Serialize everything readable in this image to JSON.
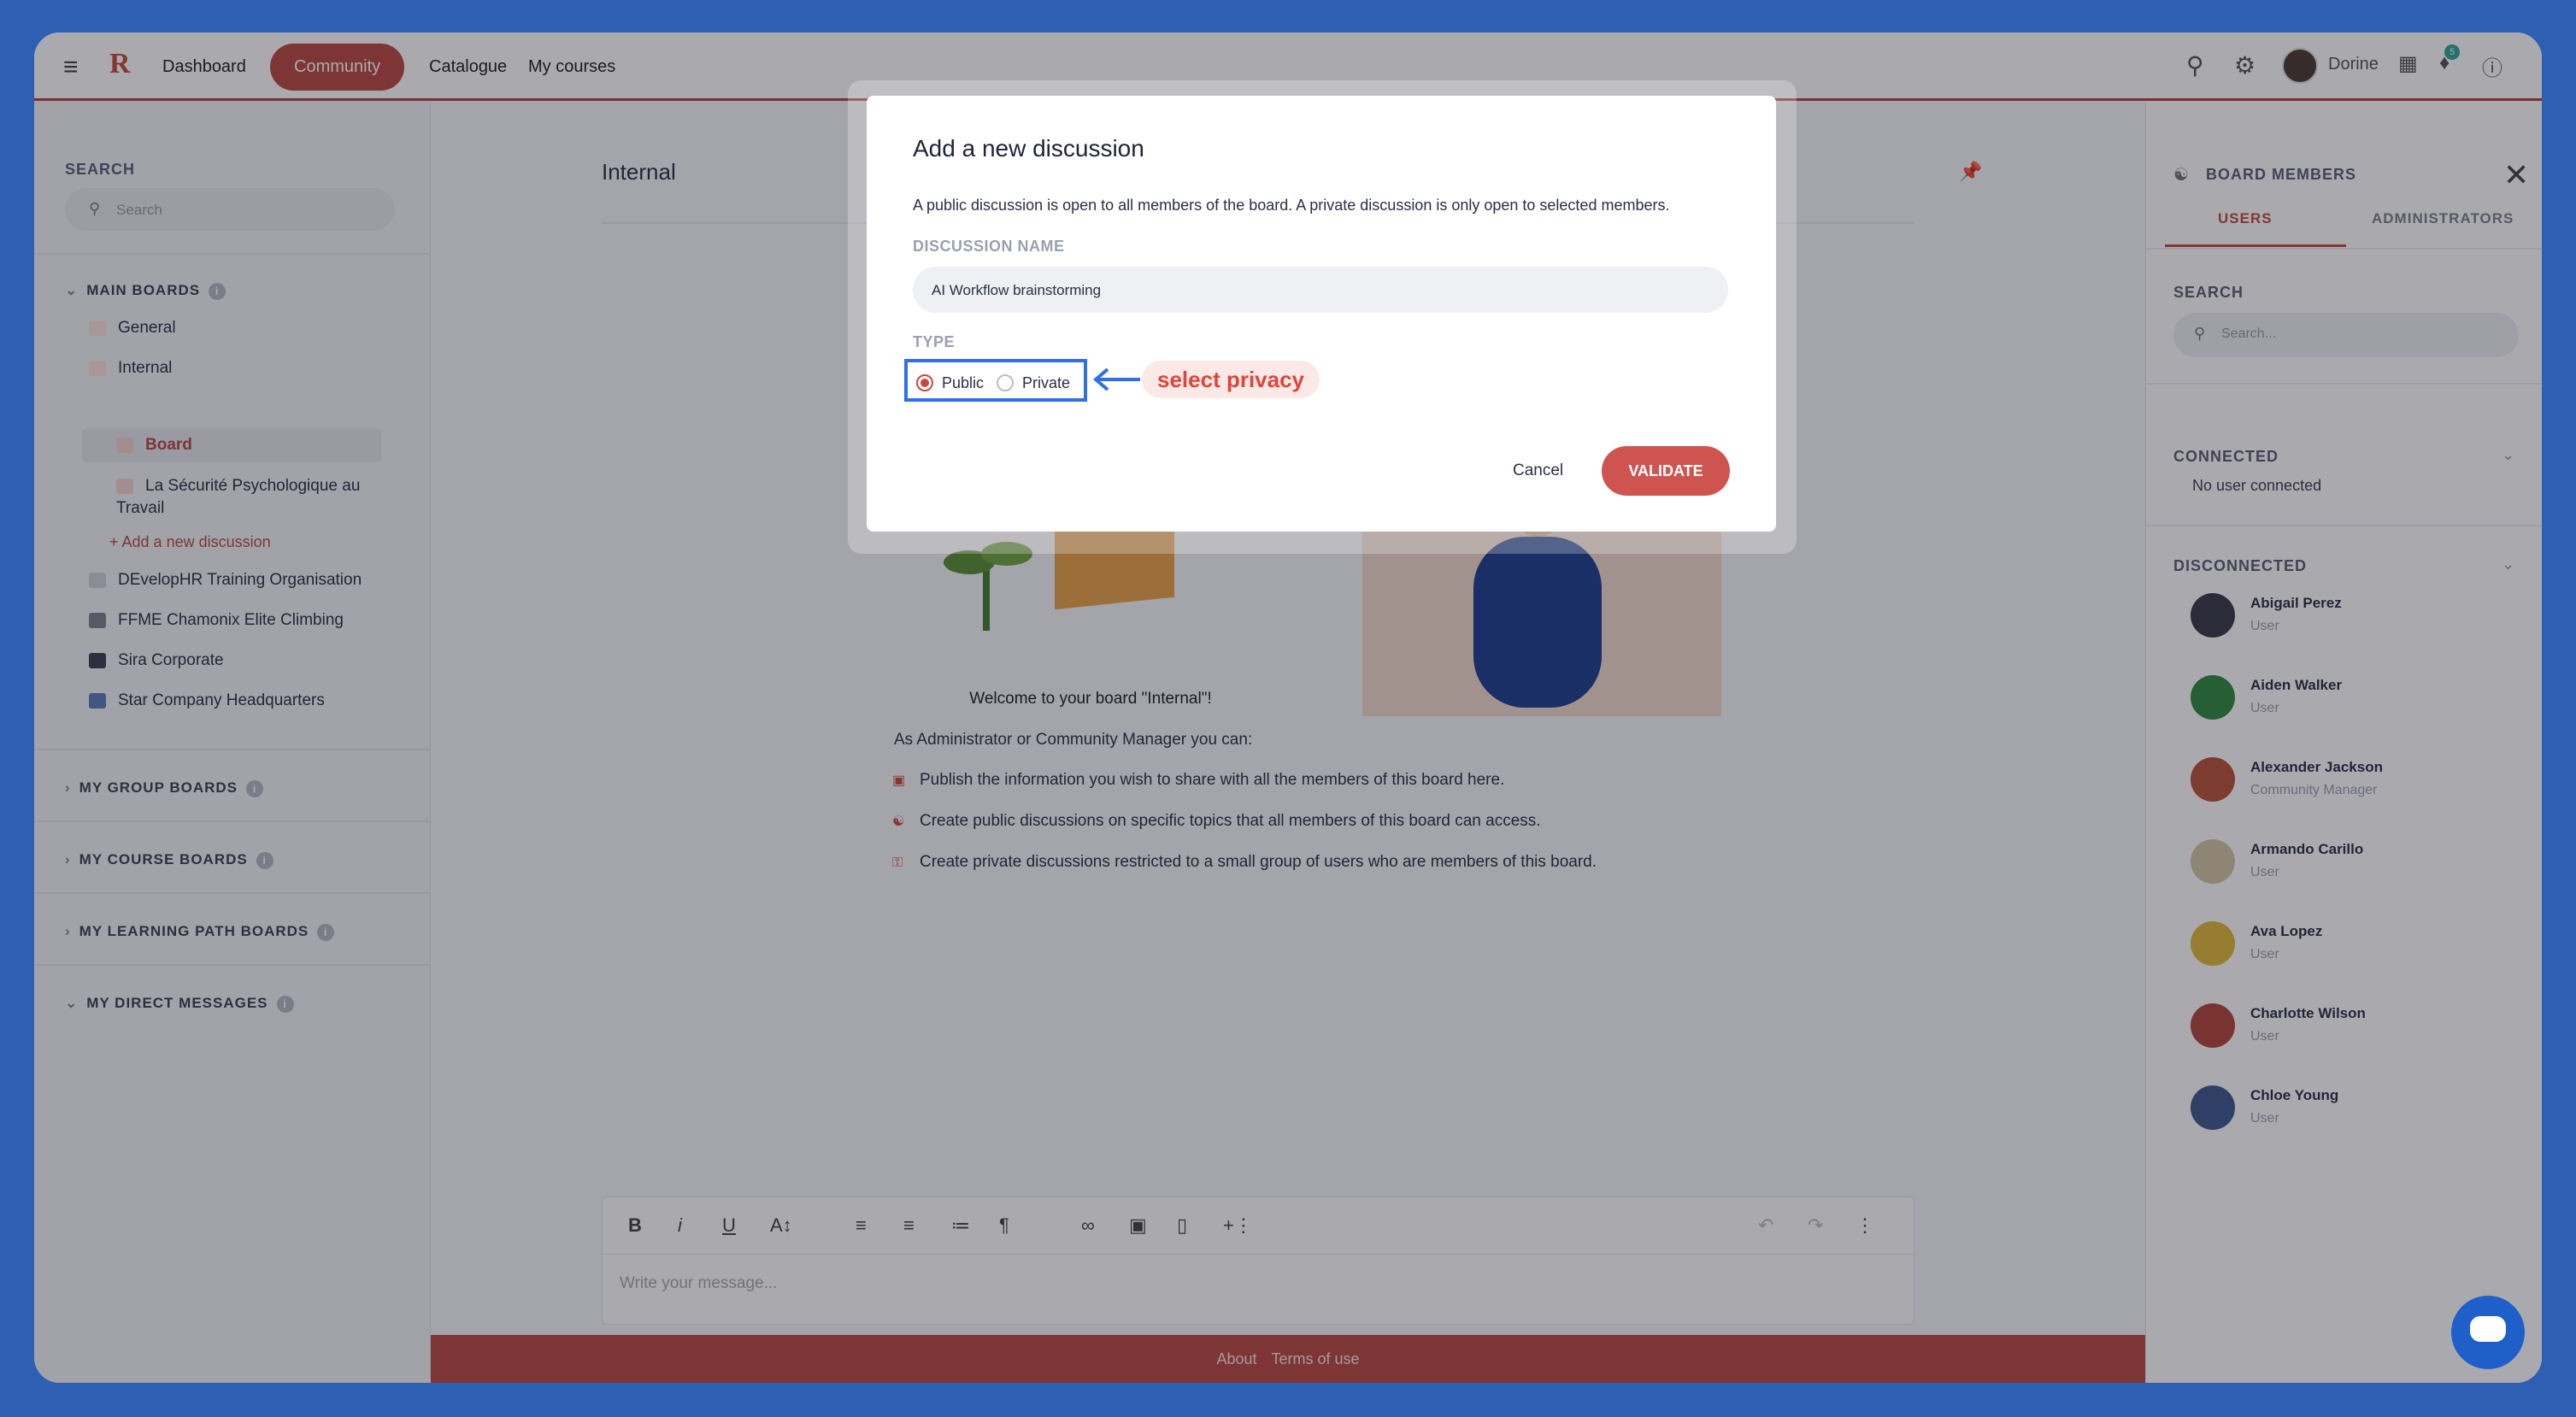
{
  "topbar": {
    "nav": [
      "Dashboard",
      "Community",
      "Catalogue",
      "My courses"
    ],
    "user": "Dorine",
    "notification_count": "5"
  },
  "sidebar": {
    "search_label": "SEARCH",
    "search_placeholder": "Search",
    "main_boards_label": "MAIN BOARDS",
    "main_items": [
      "General",
      "Internal"
    ],
    "active_item": "Board",
    "sub_item": "La Sécurité Psychologique au Travail",
    "add_discussion": "Add a new discussion",
    "other_boards": [
      "DEvelopHR Training Organisation",
      "FFME Chamonix Elite Climbing",
      "Sira Corporate",
      "Star Company Headquarters"
    ],
    "sections": [
      "MY GROUP BOARDS",
      "MY COURSE BOARDS",
      "MY LEARNING PATH BOARDS",
      "MY DIRECT MESSAGES"
    ]
  },
  "main": {
    "title": "Internal",
    "welcome": "Welcome to your board \"Internal\"!",
    "intro": "As Administrator or Community Manager you can:",
    "bullets": [
      "Publish the information you wish to share with all the members of this board here.",
      "Create public discussions on specific topics that all members of this board can access.",
      "Create private discussions restricted to a small group of users who are members of this board."
    ],
    "editor_placeholder": "Write your message..."
  },
  "footer": {
    "about": "About",
    "terms": "Terms of use"
  },
  "right_panel": {
    "title": "BOARD MEMBERS",
    "tabs": [
      "USERS",
      "ADMINISTRATORS"
    ],
    "search_label": "SEARCH",
    "search_placeholder": "Search...",
    "connected_label": "CONNECTED",
    "no_user": "No user connected",
    "disconnected_label": "DISCONNECTED",
    "members": [
      {
        "name": "Abigail Perez",
        "role": "User",
        "color": "#3b3a48"
      },
      {
        "name": "Aiden Walker",
        "role": "User",
        "color": "#2f8a3f"
      },
      {
        "name": "Alexander Jackson",
        "role": "Community Manager",
        "color": "#b8533a"
      },
      {
        "name": "Armando Carillo",
        "role": "User",
        "color": "#d5c6a6"
      },
      {
        "name": "Ava Lopez",
        "role": "User",
        "color": "#e0b93a"
      },
      {
        "name": "Charlotte Wilson",
        "role": "User",
        "color": "#b2473c"
      },
      {
        "name": "Chloe Young",
        "role": "User",
        "color": "#3e5a8f"
      }
    ]
  },
  "modal": {
    "title": "Add a new discussion",
    "description": "A public discussion is open to all members of the board. A private discussion is only open to selected members.",
    "name_label": "DISCUSSION NAME",
    "name_value": "AI Workflow brainstorming",
    "type_label": "TYPE",
    "public_label": "Public",
    "private_label": "Private",
    "annotation": "select privacy",
    "cancel": "Cancel",
    "validate": "VALIDATE"
  },
  "colors": {
    "brand": "#b94943",
    "highlight": "#2f6fe8"
  }
}
